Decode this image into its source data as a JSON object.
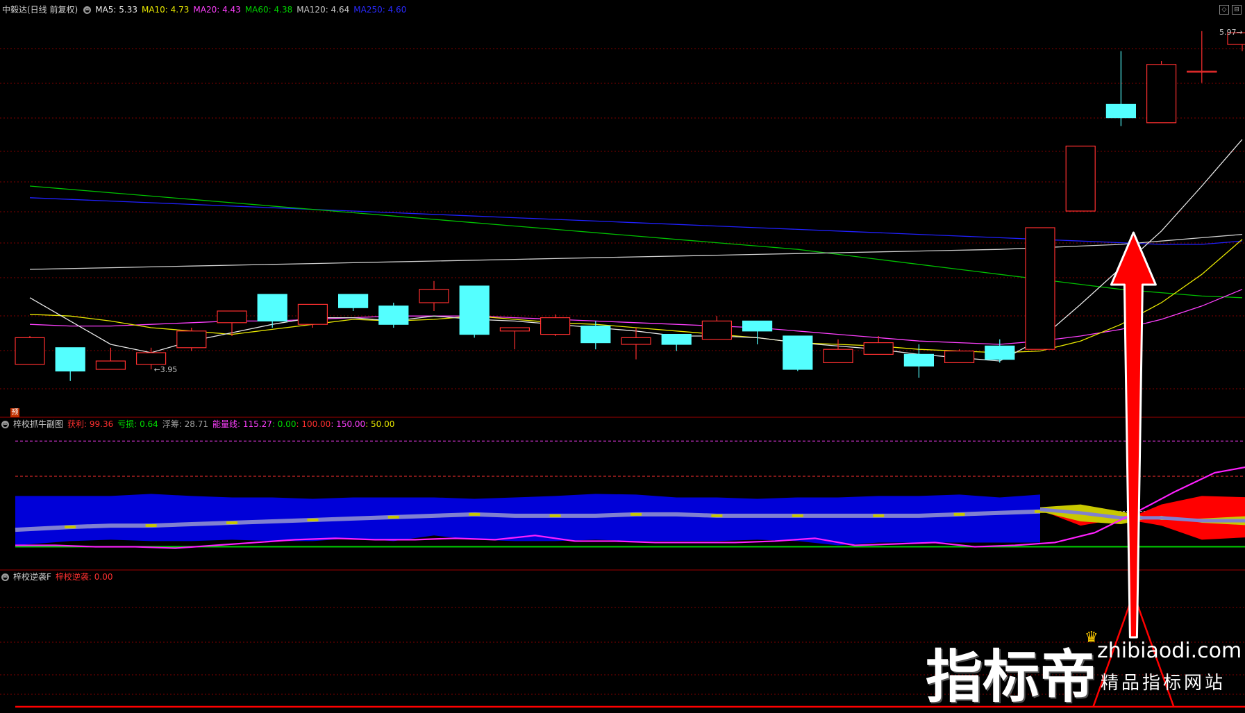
{
  "main_header": {
    "stock": "中毅达(日线 前复权)",
    "ma5": "MA5: 5.33",
    "ma10": "MA10: 4.73",
    "ma20": "MA20: 4.43",
    "ma60": "MA60: 4.38",
    "ma120": "MA120: 4.64",
    "ma250": "MA250: 4.60"
  },
  "sub1_header": {
    "name": "梓校抓牛副图",
    "profit": "获利: 99.36",
    "loss": "亏损: 0.64",
    "float": "浮筹: 28.71",
    "energy": "能量线: 115.27",
    "v1": ": 0.00",
    "v2": ": 100.00",
    "v3": ": 150.00",
    "v4": ": 50.00"
  },
  "sub2_header": {
    "name": "梓校逆袭F",
    "value": "梓校逆袭: 0.00"
  },
  "annotations": {
    "low": "←3.95",
    "high": "5.97→",
    "forecast_badge": "预"
  },
  "watermark": {
    "brand": "指标帝",
    "domain": "zhibiaodi.com",
    "tagline": "精品指标网站"
  },
  "colors": {
    "up": "#ff3030",
    "down": "#54ffff",
    "ma5": "#e8e8e8",
    "ma10": "#e8e800",
    "ma20": "#ff40ff",
    "ma60": "#00c000",
    "ma120": "#d0d0d0",
    "ma250": "#2020ff",
    "arrow": "#ff0000",
    "grid": "#800000"
  },
  "chart_data": {
    "type": "candlestick",
    "candles_ohlc": [
      [
        3.98,
        4.15,
        3.98,
        4.14
      ],
      [
        4.08,
        4.08,
        3.88,
        3.94
      ],
      [
        3.95,
        4.08,
        3.95,
        4.0
      ],
      [
        3.98,
        4.08,
        3.95,
        4.05
      ],
      [
        4.08,
        4.2,
        4.06,
        4.18
      ],
      [
        4.23,
        4.3,
        4.15,
        4.3
      ],
      [
        4.4,
        4.4,
        4.2,
        4.24
      ],
      [
        4.22,
        4.34,
        4.2,
        4.34
      ],
      [
        4.4,
        4.4,
        4.3,
        4.32
      ],
      [
        4.33,
        4.35,
        4.2,
        4.22
      ],
      [
        4.35,
        4.48,
        4.3,
        4.43
      ],
      [
        4.45,
        4.45,
        4.14,
        4.16
      ],
      [
        4.18,
        4.2,
        4.07,
        4.2
      ],
      [
        4.16,
        4.28,
        4.15,
        4.26
      ],
      [
        4.21,
        4.24,
        4.07,
        4.11
      ],
      [
        4.1,
        4.2,
        4.01,
        4.14
      ],
      [
        4.16,
        4.16,
        4.06,
        4.1
      ],
      [
        4.13,
        4.27,
        4.13,
        4.24
      ],
      [
        4.24,
        4.24,
        4.1,
        4.18
      ],
      [
        4.15,
        4.15,
        3.94,
        3.95
      ],
      [
        3.99,
        4.13,
        3.99,
        4.07
      ],
      [
        4.04,
        4.15,
        4.04,
        4.11
      ],
      [
        4.04,
        4.1,
        3.9,
        3.97
      ],
      [
        3.99,
        4.07,
        3.99,
        4.06
      ],
      [
        4.09,
        4.13,
        3.99,
        4.01
      ],
      [
        4.07,
        4.8,
        4.07,
        4.8
      ],
      [
        4.9,
        5.29,
        4.9,
        5.29
      ],
      [
        5.54,
        5.86,
        5.41,
        5.46
      ],
      [
        5.43,
        5.8,
        5.43,
        5.78
      ],
      [
        5.74,
        5.98,
        5.67,
        5.74
      ],
      [
        5.9,
        5.97,
        5.86,
        5.97
      ]
    ],
    "ma5": [
      4.38,
      4.24,
      4.1,
      4.05,
      4.12,
      4.17,
      4.22,
      4.26,
      4.26,
      4.24,
      4.27,
      4.25,
      4.24,
      4.22,
      4.2,
      4.18,
      4.15,
      4.15,
      4.14,
      4.11,
      4.09,
      4.07,
      4.04,
      4.02,
      4.0,
      4.13,
      4.34,
      4.56,
      4.78,
      5.05,
      5.33
    ],
    "ma10": [
      4.28,
      4.27,
      4.24,
      4.2,
      4.18,
      4.16,
      4.19,
      4.22,
      4.25,
      4.24,
      4.25,
      4.27,
      4.25,
      4.23,
      4.22,
      4.2,
      4.18,
      4.16,
      4.14,
      4.11,
      4.1,
      4.09,
      4.07,
      4.06,
      4.05,
      4.06,
      4.12,
      4.22,
      4.35,
      4.52,
      4.73
    ],
    "ma20": [
      4.22,
      4.21,
      4.21,
      4.22,
      4.23,
      4.24,
      4.24,
      4.25,
      4.26,
      4.27,
      4.27,
      4.27,
      4.26,
      4.25,
      4.24,
      4.23,
      4.22,
      4.21,
      4.2,
      4.18,
      4.16,
      4.14,
      4.12,
      4.11,
      4.1,
      4.12,
      4.15,
      4.19,
      4.25,
      4.33,
      4.43
    ],
    "ma60": [
      5.05,
      5.03,
      5.01,
      4.99,
      4.97,
      4.95,
      4.93,
      4.91,
      4.89,
      4.87,
      4.85,
      4.83,
      4.81,
      4.79,
      4.77,
      4.75,
      4.73,
      4.71,
      4.69,
      4.67,
      4.64,
      4.61,
      4.58,
      4.55,
      4.52,
      4.49,
      4.46,
      4.43,
      4.41,
      4.39,
      4.38
    ],
    "ma120": [
      4.55,
      4.555,
      4.56,
      4.565,
      4.57,
      4.575,
      4.58,
      4.585,
      4.59,
      4.595,
      4.6,
      4.605,
      4.61,
      4.615,
      4.62,
      4.625,
      4.63,
      4.635,
      4.64,
      4.645,
      4.65,
      4.655,
      4.66,
      4.665,
      4.67,
      4.68,
      4.69,
      4.7,
      4.72,
      4.74,
      4.76
    ],
    "ma250": [
      4.98,
      4.97,
      4.96,
      4.95,
      4.94,
      4.93,
      4.92,
      4.91,
      4.9,
      4.89,
      4.88,
      4.87,
      4.86,
      4.85,
      4.84,
      4.83,
      4.82,
      4.81,
      4.8,
      4.79,
      4.78,
      4.77,
      4.76,
      4.75,
      4.74,
      4.73,
      4.72,
      4.71,
      4.7,
      4.7,
      4.72
    ],
    "price_ylim": [
      3.75,
      6.05
    ],
    "sub1": {
      "ylim": [
        -30,
        165
      ],
      "energy": [
        2,
        2,
        0,
        0,
        -2,
        2,
        6,
        10,
        12,
        10,
        10,
        12,
        10,
        16,
        8,
        8,
        6,
        6,
        6,
        8,
        12,
        2,
        4,
        6,
        0,
        2,
        6,
        20,
        48,
        78,
        105,
        115.27
      ],
      "energy_x": [
        0,
        1,
        2,
        3,
        3.3,
        4,
        5,
        6,
        7,
        8,
        9,
        10,
        11,
        12,
        13,
        14,
        15,
        16,
        17,
        18,
        19,
        20,
        21,
        22,
        23,
        24,
        24.3,
        25,
        26,
        27,
        28,
        29,
        30
      ],
      "band_top": [
        72,
        72,
        72,
        75,
        72,
        70,
        70,
        68,
        70,
        70,
        70,
        68,
        70,
        72,
        75,
        74,
        70,
        70,
        68,
        70,
        70,
        72,
        72,
        74,
        70,
        74
      ],
      "band_bottom": [
        2,
        8,
        10,
        8,
        8,
        10,
        8,
        8,
        12,
        8,
        16,
        10,
        8,
        8,
        10,
        8,
        8,
        8,
        10,
        8,
        2,
        6,
        6,
        6,
        6,
        6
      ],
      "mid_line": [
        24,
        28,
        30,
        30,
        32,
        34,
        36,
        38,
        40,
        42,
        44,
        46,
        44,
        44,
        44,
        46,
        46,
        44,
        44,
        44,
        44,
        44,
        44,
        46,
        48,
        50
      ],
      "red_top": [
        56,
        40,
        36,
        60,
        72,
        70
      ],
      "red_bottom": [
        52,
        30,
        40,
        30,
        10,
        14
      ],
      "yellow_top": [
        56,
        60,
        50,
        38,
        40,
        44
      ],
      "yellow_bottom": [
        50,
        36,
        32,
        44,
        34,
        30
      ],
      "ref_lines": [
        0.0,
        100.0,
        150.0,
        50.0
      ]
    },
    "sub2": {
      "value": 0.0
    }
  }
}
